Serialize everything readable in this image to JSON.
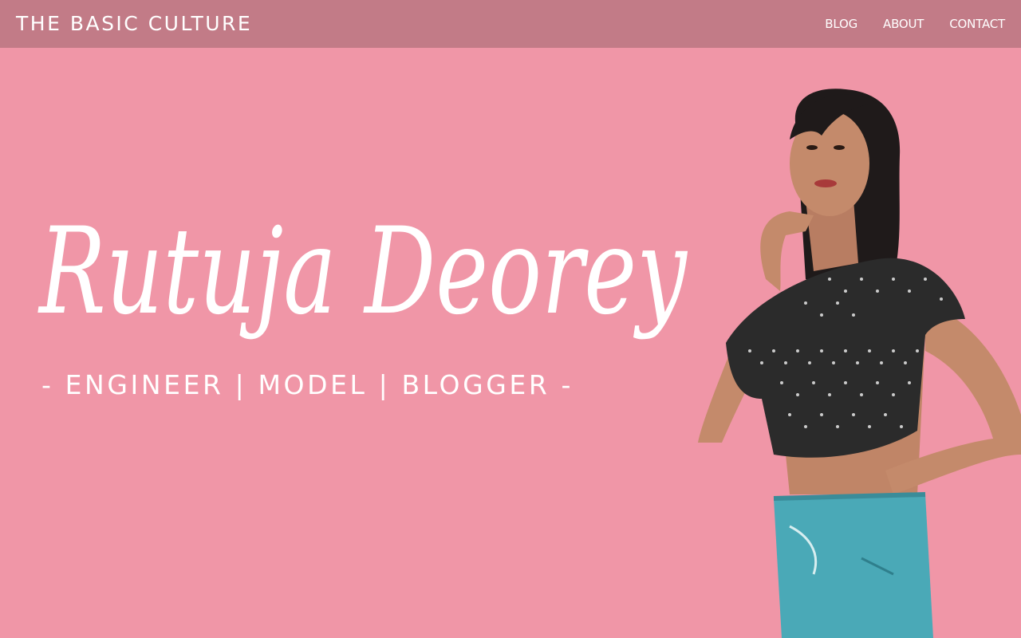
{
  "site": {
    "title": "THE BASIC CULTURE"
  },
  "nav": {
    "items": [
      {
        "label": "BLOG"
      },
      {
        "label": "ABOUT"
      },
      {
        "label": "CONTACT"
      }
    ]
  },
  "hero": {
    "name": "Rutuja Deorey",
    "roles": "- ENGINEER | MODEL | BLOGGER -",
    "photo_icon": "model-photo"
  },
  "colors": {
    "background": "#f096a7",
    "navbar": "#c27b87",
    "text": "#ffffff",
    "top_dark": "#2b2b2b",
    "denim": "#4aa9b7",
    "skin": "#c48a6b"
  }
}
